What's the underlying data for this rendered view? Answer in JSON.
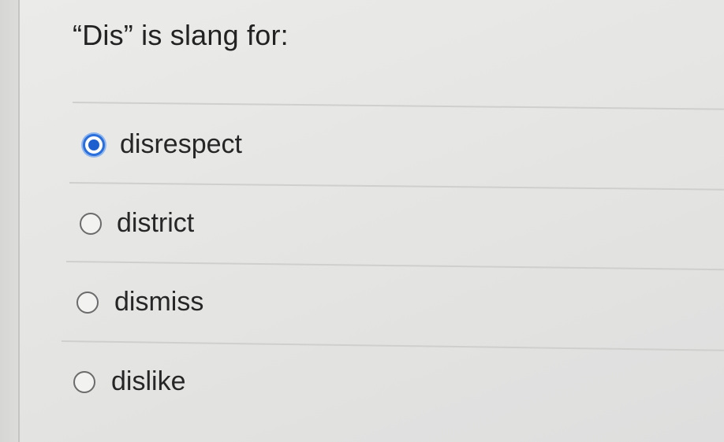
{
  "question": {
    "text": "“Dis” is slang for:"
  },
  "options": [
    {
      "label": "disrespect",
      "selected": true
    },
    {
      "label": "district",
      "selected": false
    },
    {
      "label": "dismiss",
      "selected": false
    },
    {
      "label": "dislike",
      "selected": false
    }
  ],
  "colors": {
    "background": "#e4e4e2",
    "selected_radio": "#1e5fd0",
    "text": "#222222"
  }
}
